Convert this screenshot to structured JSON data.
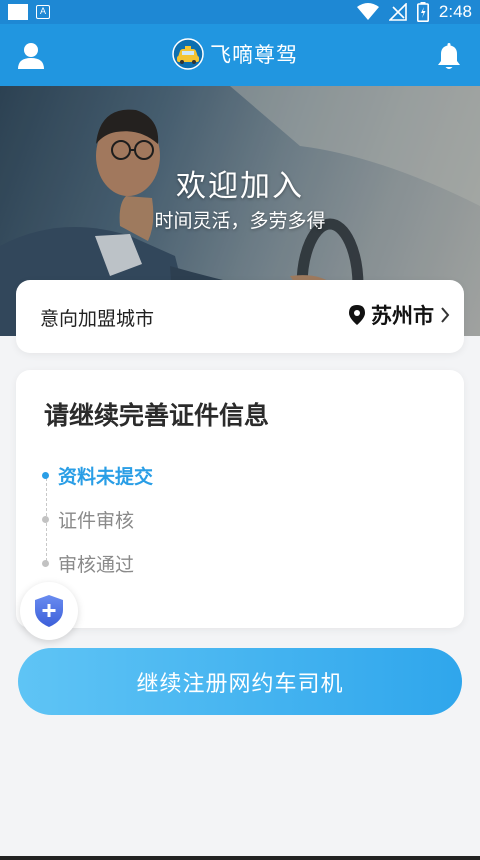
{
  "status_bar": {
    "time": "2:48",
    "badge": "A"
  },
  "header": {
    "app_name": "飞嘀尊驾"
  },
  "hero": {
    "title": "欢迎加入",
    "subtitle": "时间灵活，多劳多得"
  },
  "city": {
    "label": "意向加盟城市",
    "value": "苏州市"
  },
  "info": {
    "title": "请继续完善证件信息",
    "steps": [
      {
        "label": "资料未提交",
        "active": true
      },
      {
        "label": "证件审核",
        "active": false
      },
      {
        "label": "审核通过",
        "active": false
      }
    ]
  },
  "cta": {
    "label": "继续注册网约车司机"
  },
  "colors": {
    "primary": "#2196e0",
    "accent": "#2a9ee6",
    "status_bar": "#1e88d4"
  }
}
